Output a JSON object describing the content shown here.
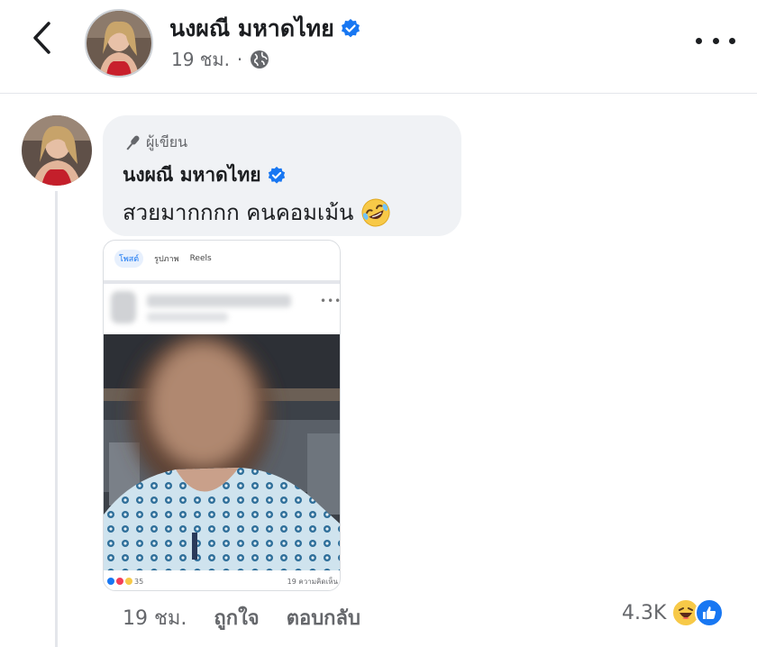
{
  "header": {
    "back_icon": "chevron-left-icon",
    "name": "นงผณี มหาดไทย",
    "verified_icon": "verified-badge-icon",
    "time": "19 ชม.",
    "separator": "·",
    "privacy_icon": "globe-icon",
    "more_icon": "more-horizontal-icon"
  },
  "comment": {
    "author_badge": "ผู้เขียน",
    "author_badge_icon": "microphone-icon",
    "name": "นงผณี มหาดไทย",
    "text": "สวยมากกกก คนคอมเม้น",
    "emoji_icon": "rolling-on-floor-laughing-emoji-icon",
    "time": "19 ชม.",
    "like_label": "ถูกใจ",
    "reply_label": "ตอบกลับ",
    "reaction_count": "4.3K",
    "reaction_icons": [
      "haha-reaction-icon",
      "like-reaction-icon"
    ]
  },
  "attachment": {
    "tabs": [
      "โพสต์",
      "รูปภาพ",
      "Reels"
    ],
    "reaction_count": "35",
    "comment_count": "19 ความคิดเห็น"
  },
  "colors": {
    "accent_blue": "#1877f2",
    "bubble_bg": "#f0f2f5",
    "meta_gray": "#65676b",
    "haha_yellow": "#f7c948"
  }
}
